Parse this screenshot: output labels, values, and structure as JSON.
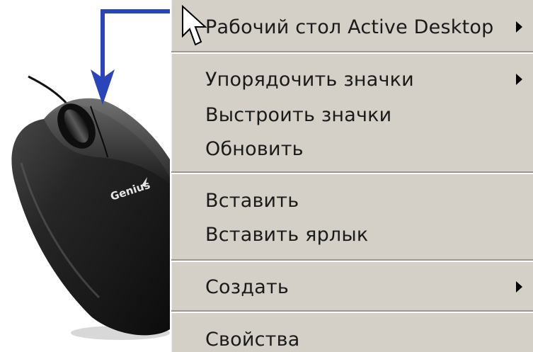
{
  "illustration": {
    "brand_text": "Genius"
  },
  "context_menu": {
    "items": [
      {
        "label": "Рабочий стол Active Desktop",
        "has_submenu": true
      },
      {
        "label": "Упорядочить значки",
        "has_submenu": true
      },
      {
        "label": "Выстроить значки",
        "has_submenu": false
      },
      {
        "label": "Обновить",
        "has_submenu": false
      },
      {
        "label": "Вставить",
        "has_submenu": false
      },
      {
        "label": "Вставить ярлык",
        "has_submenu": false
      },
      {
        "label": "Создать",
        "has_submenu": true
      },
      {
        "label": "Свойства",
        "has_submenu": false
      }
    ]
  },
  "colors": {
    "menu_background": "#d4d0c8",
    "arrow_annotation": "#2a45b8",
    "mouse_body": "#1c1c1c"
  }
}
